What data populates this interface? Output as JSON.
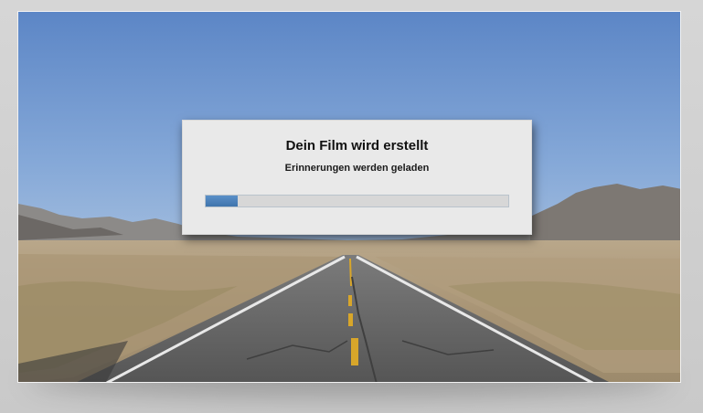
{
  "dialog": {
    "title": "Dein Film wird erstellt",
    "subtitle": "Erinnerungen werden geladen",
    "progress_fraction": 0.105,
    "progress_color": "#4a80bb"
  },
  "background": {
    "description_icon": "desert-road-photo",
    "sky_color": "#6f93c8"
  }
}
